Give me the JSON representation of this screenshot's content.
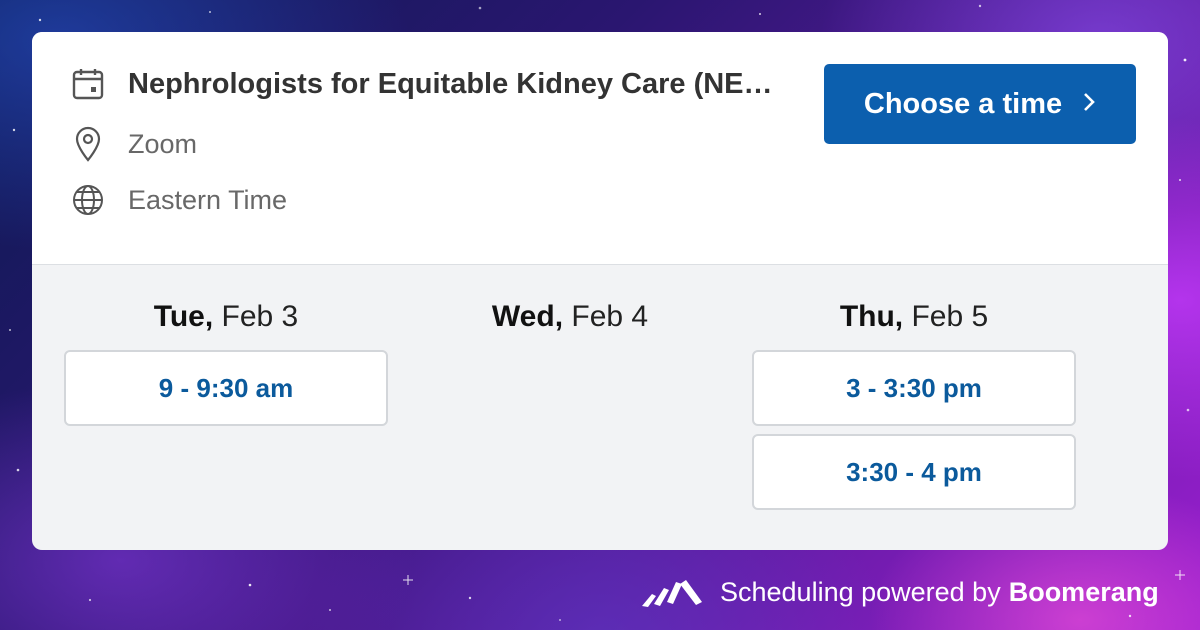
{
  "event": {
    "title": "Nephrologists for Equitable Kidney Care (NE…",
    "location": "Zoom",
    "timezone": "Eastern Time"
  },
  "icons": {
    "calendar": "calendar-icon",
    "location": "location-pin-icon",
    "timezone": "globe-icon",
    "chevron": "chevron-right-icon",
    "logo": "boomerang-logo-icon"
  },
  "cta": {
    "label": "Choose a time"
  },
  "days": [
    {
      "weekday": "Tue,",
      "date": " Feb 3",
      "slots": [
        "9 - 9:30 am"
      ]
    },
    {
      "weekday": "Wed,",
      "date": " Feb 4",
      "slots": []
    },
    {
      "weekday": "Thu,",
      "date": " Feb 5",
      "slots": [
        "3 - 3:30 pm",
        "3:30 - 4 pm"
      ]
    }
  ],
  "footer": {
    "text": "Scheduling powered by",
    "brand": "Boomerang"
  },
  "colors": {
    "accent": "#0c5fae",
    "slot_text": "#0b5a9c",
    "card_bg": "#f2f3f5"
  }
}
